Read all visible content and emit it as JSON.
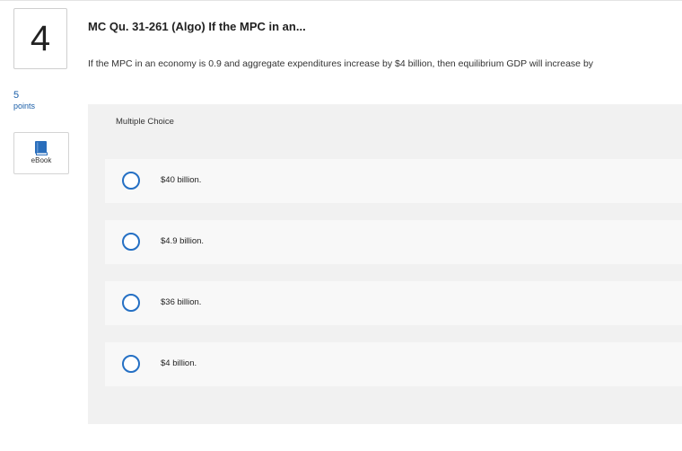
{
  "question": {
    "number": "4",
    "points_value": "5",
    "points_label": "points",
    "title": "MC Qu. 31-261 (Algo) If the MPC in an...",
    "text": "If the MPC in an economy is 0.9 and aggregate expenditures increase by $4 billion, then equilibrium GDP will increase by"
  },
  "ebook": {
    "label": "eBook",
    "icon": "book-icon",
    "icon_color": "#2a6ebb"
  },
  "multiple_choice": {
    "label": "Multiple Choice",
    "options": [
      {
        "text": "$40 billion.",
        "selected": false
      },
      {
        "text": "$4.9 billion.",
        "selected": false
      },
      {
        "text": "$36 billion.",
        "selected": false
      },
      {
        "text": "$4 billion.",
        "selected": false
      }
    ]
  },
  "colors": {
    "accent": "#2570c4",
    "points": "#1a5ea8",
    "panel_bg": "#f1f1f1",
    "choice_bg": "#f8f8f8"
  }
}
